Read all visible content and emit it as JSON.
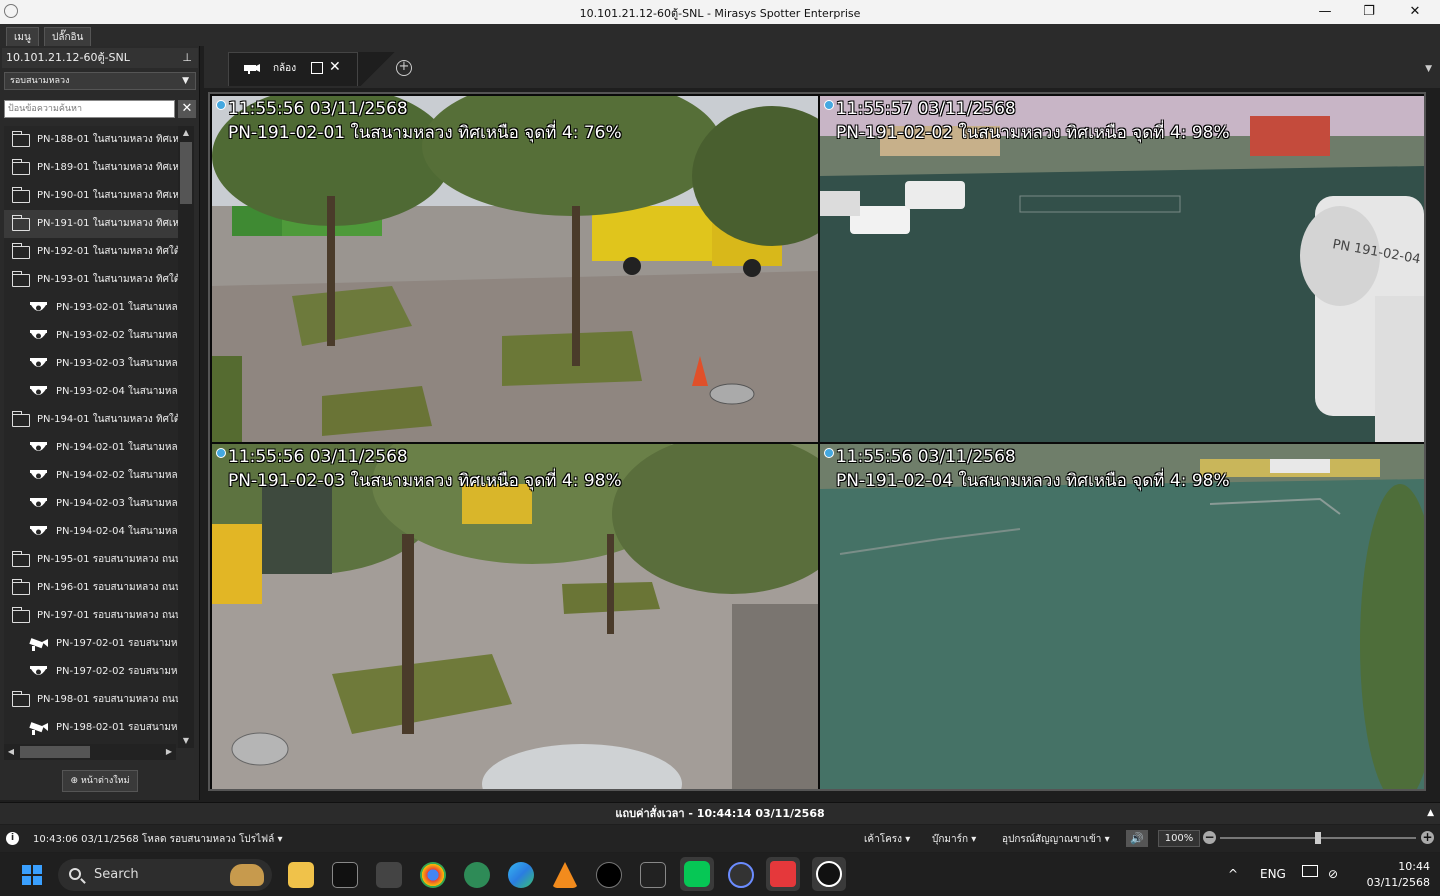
{
  "window": {
    "title": "10.101.21.12-60ตู้-SNL - Mirasys Spotter Enterprise",
    "minimize": "—",
    "maximize": "❐",
    "close": "✕"
  },
  "menu_tabs": [
    "เมนู",
    "ปลั๊กอิน"
  ],
  "sidebar": {
    "server": "10.101.21.12-60ตู้-SNL",
    "pin": "⊥",
    "group_select": "รอบสนามหลวง",
    "search_placeholder": "ป้อนข้อความค้นหา",
    "new_window_label": "⊕ หน้าต่างใหม่",
    "tree": [
      {
        "type": "folder",
        "label": "PN-188-01 ในสนามหลวง ทิศเห"
      },
      {
        "type": "folder",
        "label": "PN-189-01 ในสนามหลวง ทิศเห"
      },
      {
        "type": "folder",
        "label": "PN-190-01 ในสนามหลวง ทิศเห"
      },
      {
        "type": "folder",
        "label": "PN-191-01 ในสนามหลวง ทิศเห",
        "selected": true
      },
      {
        "type": "folder",
        "label": "PN-192-01 ในสนามหลวง ทิศใต้"
      },
      {
        "type": "folder",
        "label": "PN-193-01 ในสนามหลวง ทิศใต้"
      },
      {
        "type": "dome",
        "label": "PN-193-02-01 ในสนามหล"
      },
      {
        "type": "dome",
        "label": "PN-193-02-02 ในสนามหล"
      },
      {
        "type": "dome",
        "label": "PN-193-02-03 ในสนามหล"
      },
      {
        "type": "dome",
        "label": "PN-193-02-04 ในสนามหล"
      },
      {
        "type": "folder",
        "label": "PN-194-01 ในสนามหลวง ทิศใต้"
      },
      {
        "type": "dome",
        "label": "PN-194-02-01 ในสนามหล"
      },
      {
        "type": "dome",
        "label": "PN-194-02-02 ในสนามหล"
      },
      {
        "type": "dome",
        "label": "PN-194-02-03 ในสนามหล"
      },
      {
        "type": "dome",
        "label": "PN-194-02-04 ในสนามหล"
      },
      {
        "type": "folder",
        "label": "PN-195-01 รอบสนามหลวง ถนน"
      },
      {
        "type": "folder",
        "label": "PN-196-01 รอบสนามหลวง ถนน"
      },
      {
        "type": "folder",
        "label": "PN-197-01 รอบสนามหลวง ถนน"
      },
      {
        "type": "bullet",
        "label": "PN-197-02-01 รอบสนามห"
      },
      {
        "type": "dome",
        "label": "PN-197-02-02 รอบสนามห"
      },
      {
        "type": "folder",
        "label": "PN-198-01 รอบสนามหลวง ถนน"
      },
      {
        "type": "bullet",
        "label": "PN-198-02-01 รอบสนามห"
      },
      {
        "type": "bullet",
        "label": ""
      }
    ]
  },
  "view_tab": {
    "label": "กล้อง",
    "add": "+",
    "menu": "▼"
  },
  "cameras": [
    {
      "time": "11:55:56  03/11/2568",
      "name": "PN-191-02-01 ในสนามหลวง ทิศเหนือ จุดที่ 4: 76%"
    },
    {
      "time": "11:55:57  03/11/2568",
      "name": "PN-191-02-02 ในสนามหลวง ทิศเหนือ จุดที่ 4: 98%"
    },
    {
      "time": "11:55:56  03/11/2568",
      "name": "PN-191-02-03 ในสนามหลวง ทิศเหนือ จุดที่ 4: 98%"
    },
    {
      "time": "11:55:56  03/11/2568",
      "name": "PN-191-02-04 ในสนามหลวง ทิศเหนือ จุดที่ 4: 98%"
    }
  ],
  "camera_marking": "PN 191-02-04",
  "timeline": {
    "label": "แถบค่าสั่งเวลา - 10:44:14  03/11/2568",
    "caret": "▲"
  },
  "status": {
    "info": "i",
    "message": "10:43:06  03/11/2568 โหลด รอบสนามหลวง โปรไฟล์ ▾",
    "layout": "เค้าโครง ▾",
    "bookmarks": "บุ๊กมาร์ก ▾",
    "alarm_devices": "อุปกรณ์สัญญาณขาเข้า ▾",
    "volume": "🔊",
    "zoom": "100%",
    "zoom_out": "−",
    "zoom_in": "+",
    "zoom_fraction": 0.5
  },
  "taskbar": {
    "search": "Search",
    "lang": "ENG",
    "time": "10:44",
    "date": "03/11/2568",
    "caret": "^"
  },
  "colors": {
    "rec_dot": "#44a8e0",
    "win_blue": "#3aa0ff",
    "line_green": "#06c755",
    "red_app": "#e5383b"
  }
}
